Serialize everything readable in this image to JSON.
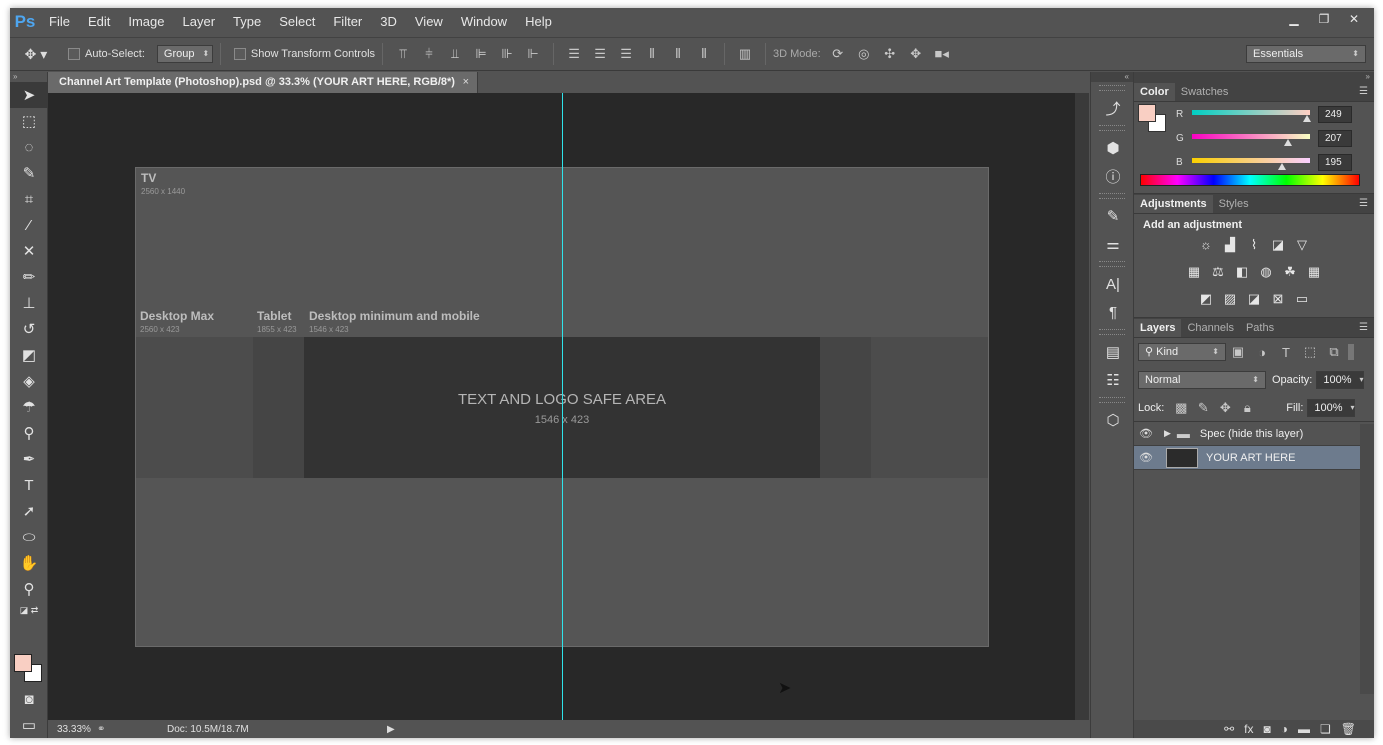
{
  "app": {
    "logo": "Ps",
    "accent": "#4ea6f0"
  },
  "menu": [
    "File",
    "Edit",
    "Image",
    "Layer",
    "Type",
    "Select",
    "Filter",
    "3D",
    "View",
    "Window",
    "Help"
  ],
  "window_controls": {
    "minimize": "▁",
    "restore": "❐",
    "close": "✕"
  },
  "options": {
    "auto_select_label": "Auto-Select:",
    "auto_select_value": "Group",
    "transform_label": "Show Transform Controls",
    "mode_3d_label": "3D Mode:",
    "workspace": "Essentials"
  },
  "document": {
    "tab_title": "Channel Art Template (Photoshop).psd @ 33.3% (YOUR ART HERE, RGB/8*)",
    "close": "×",
    "labels": {
      "tv": "TV",
      "tv_size": "2560 x 1440",
      "desktop_max": "Desktop Max",
      "desktop_max_size": "2560 x 423",
      "tablet": "Tablet",
      "tablet_size": "1855 x 423",
      "desktop_min": "Desktop minimum and mobile",
      "desktop_min_size": "1546 x 423",
      "safe_area": "TEXT AND LOGO SAFE AREA",
      "safe_area_size": "1546 x 423"
    },
    "guide_color": "#2fe3ea"
  },
  "status": {
    "zoom": "33.33%",
    "doc": "Doc: 10.5M/18.7M"
  },
  "swatches": {
    "foreground": "#f9cfc3",
    "background": "#ffffff"
  },
  "color_panel": {
    "tabs": [
      "Color",
      "Swatches"
    ],
    "r_label": "R",
    "r": 249,
    "g_label": "G",
    "g": 207,
    "b_label": "B",
    "b": 195
  },
  "adjustments_panel": {
    "tabs": [
      "Adjustments",
      "Styles"
    ],
    "heading": "Add an adjustment"
  },
  "layers_panel": {
    "tabs": [
      "Layers",
      "Channels",
      "Paths"
    ],
    "filter": "Kind",
    "blend_mode": "Normal",
    "opacity_label": "Opacity:",
    "opacity": "100%",
    "lock_label": "Lock:",
    "fill_label": "Fill:",
    "fill": "100%",
    "layers": [
      {
        "name": "Spec (hide this layer)",
        "type": "group"
      },
      {
        "name": "YOUR ART HERE",
        "type": "layer",
        "selected": true
      }
    ]
  }
}
